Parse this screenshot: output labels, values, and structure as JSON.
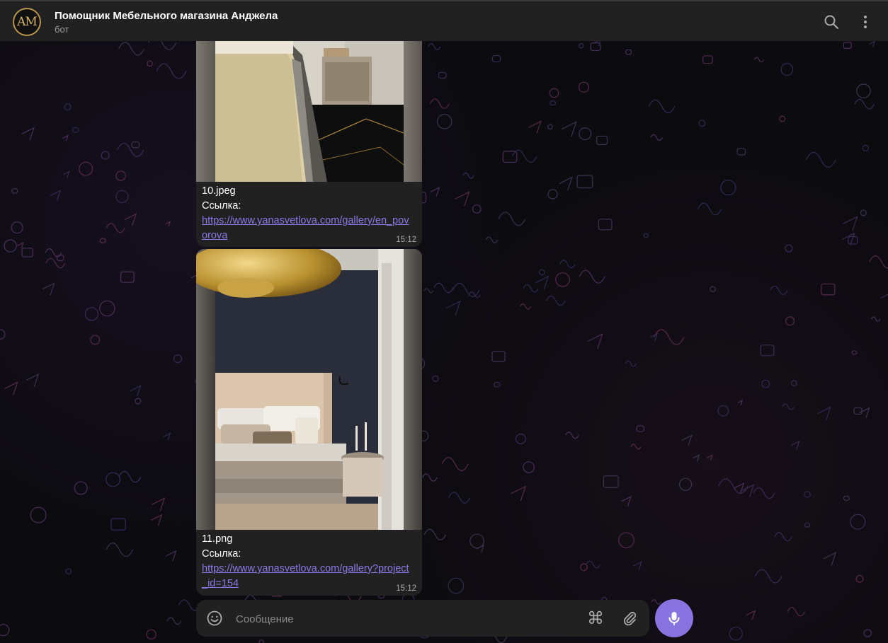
{
  "header": {
    "avatar_monogram": "AM",
    "title": "Помощник Мебельного магазина Анджела",
    "subtitle": "бот",
    "search_icon": "search-icon",
    "more_icon": "more-vertical-icon"
  },
  "messages": [
    {
      "filename": "10.jpeg",
      "link_label": "Ссылка:",
      "link_url": "https://www.yanasvetlova.com/gallery/en_povorova",
      "time": "15:12"
    },
    {
      "filename": "11.png",
      "link_label": "Ссылка:",
      "link_url": "https://www.yanasvetlova.com/gallery?project_id=154",
      "time": "15:12"
    }
  ],
  "composer": {
    "placeholder": "Сообщение",
    "emoji_icon": "smile-icon",
    "commands_icon": "command-icon",
    "commands_glyph": "⌘",
    "attach_icon": "paperclip-icon",
    "mic_icon": "microphone-icon"
  },
  "colors": {
    "accent": "#8774e1",
    "link": "#8d78e6",
    "bubble": "#212121",
    "header": "#212121"
  }
}
